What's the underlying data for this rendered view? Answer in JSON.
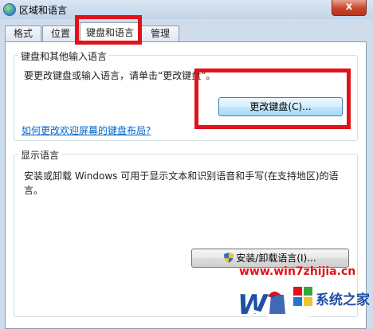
{
  "window": {
    "title": "区域和语言",
    "close_label": "x"
  },
  "tabs": [
    {
      "label": "格式"
    },
    {
      "label": "位置"
    },
    {
      "label": "键盘和语言"
    },
    {
      "label": "管理"
    }
  ],
  "keyboard_group": {
    "legend": "键盘和其他输入语言",
    "description": "要更改键盘或输入语言，请单击“更改键盘”。",
    "change_button": "更改键盘(C)...",
    "link": "如何更改欢迎屏幕的键盘布局?"
  },
  "display_group": {
    "legend": "显示语言",
    "description": "安装或卸载 Windows 可用于显示文本和识别语音和手写(在支持地区)的语言。",
    "install_button": "安装/卸载语言(I)..."
  },
  "watermark": {
    "url": "www.win7zhijia.cn",
    "brand": "系统之家"
  },
  "colors": {
    "highlight": "#e0131b",
    "link": "#0066cc"
  }
}
